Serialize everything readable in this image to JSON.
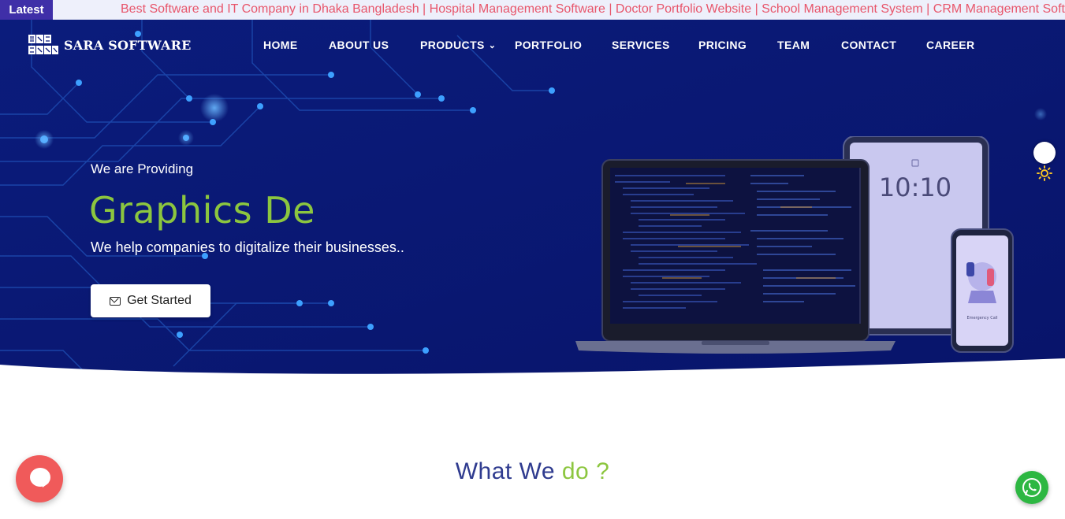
{
  "ticker": {
    "label": "Latest",
    "text": "Best Software and IT Company in Dhaka Bangladesh | Hospital Management Software | Doctor Portfolio Website | School Management System | CRM Management Software"
  },
  "brand": {
    "logo_mark": "SA RA",
    "name": "SARA SOFTWARE"
  },
  "nav": {
    "items": [
      "HOME",
      "ABOUT US",
      "PRODUCTS",
      "PORTFOLIO",
      "SERVICES",
      "PRICING",
      "TEAM",
      "CONTACT",
      "CAREER"
    ]
  },
  "hero": {
    "subtitle": "We are Providing",
    "title": "Graphics De",
    "description": "We help companies to digitalize their businesses..",
    "cta_label": "Get Started",
    "tablet_time": "10:10",
    "phone_caption": "Emergency Call"
  },
  "section": {
    "title_part1": "What We ",
    "title_part2": "do ?"
  },
  "colors": {
    "hero_bg": "#0a1a7a",
    "accent_green": "#8cc63f",
    "ticker_label_bg": "#3f2fa8",
    "ticker_text": "#e8566b",
    "section_title": "#2f3b8f",
    "chat_button": "#f05a5a",
    "whatsapp": "#2db742"
  },
  "icons": {
    "menu_chevron": "chevron-down-icon",
    "cta": "mail-icon",
    "theme": "sun-icon",
    "chat": "chat-icon",
    "whatsapp": "whatsapp-icon"
  }
}
